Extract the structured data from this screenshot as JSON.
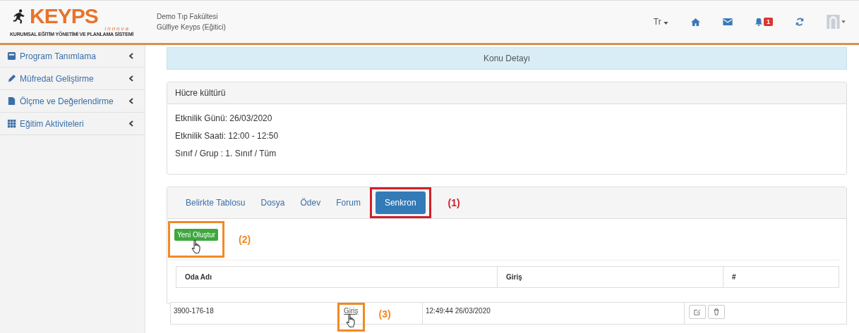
{
  "header": {
    "logo": {
      "brand": "KEYPS",
      "sub": "innova",
      "tagline": "KURUMSAL EĞİTİM YÖNETİMİ VE PLANLAMA SİSTEMİ"
    },
    "institution": "Demo Tıp Fakültesi",
    "user": "Gülfiye Keyps (Eğitici)",
    "language": "Tr",
    "notification_count": "1"
  },
  "sidebar": {
    "items": [
      {
        "label": "Program Tanımlama"
      },
      {
        "label": "Müfredat Geliştirme"
      },
      {
        "label": "Ölçme ve Değerlendirme"
      },
      {
        "label": "Eğitim Aktiviteleri"
      }
    ]
  },
  "page_title": "Konu Detayı",
  "topic": {
    "title": "Hücre kültürü",
    "details": [
      "Etknilik Günü: 26/03/2020",
      "Etknilik Saati: 12:00 - 12:50",
      "Sınıf / Grup : 1. Sınıf / Tüm"
    ]
  },
  "tabs": [
    {
      "label": "Belirkte Tablosu",
      "selected": false
    },
    {
      "label": "Dosya",
      "selected": false
    },
    {
      "label": "Ödev",
      "selected": false
    },
    {
      "label": "Forum",
      "selected": false
    },
    {
      "label": "Senkron",
      "selected": true
    }
  ],
  "create_button": "Yeni Oluştur",
  "table": {
    "columns": [
      "Oda Adı",
      "Giriş",
      "#"
    ],
    "rows": [
      {
        "room": "3900-176-18",
        "link": "Giriş",
        "time": "12:49:44 26/03/2020"
      }
    ]
  },
  "annotations": [
    {
      "label": "(1)",
      "color": "#d0202a"
    },
    {
      "label": "(2)",
      "color": "#f08a24"
    },
    {
      "label": "(3)",
      "color": "#f08a24"
    }
  ]
}
